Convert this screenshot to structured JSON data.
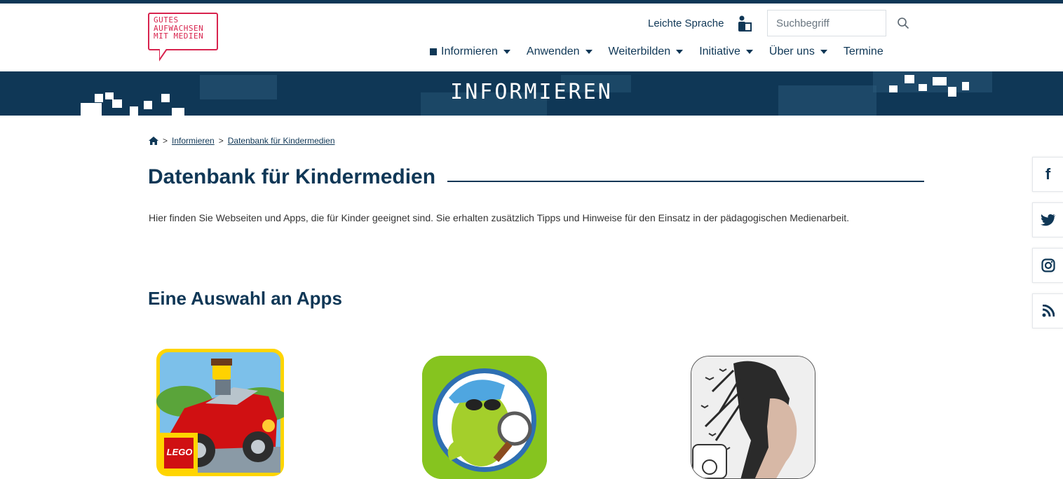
{
  "logo": {
    "line1": "GUTES",
    "line2": "AUFWACHSEN",
    "line3": "MIT MEDIEN"
  },
  "header": {
    "leichte_sprache": "Leichte Sprache",
    "search_placeholder": "Suchbegriff"
  },
  "nav": {
    "items": [
      {
        "label": "Informieren",
        "active": true,
        "dropdown": true
      },
      {
        "label": "Anwenden",
        "dropdown": true
      },
      {
        "label": "Weiterbilden",
        "dropdown": true
      },
      {
        "label": "Initiative",
        "dropdown": true
      },
      {
        "label": "Über uns",
        "dropdown": true
      },
      {
        "label": "Termine",
        "dropdown": false
      }
    ]
  },
  "banner": {
    "title": "INFORMIEREN"
  },
  "breadcrumb": {
    "home_icon": "home-icon",
    "items": [
      "Informieren",
      "Datenbank für Kindermedien"
    ],
    "separator": ">"
  },
  "page": {
    "title": "Datenbank für Kindermedien",
    "intro": "Hier finden Sie Webseiten und Apps, die für Kinder geeignet sind. Sie erhalten zusätzlich Tipps und Hinweise für den Einsatz in der pädagogischen Medienarbeit.",
    "section_title": "Eine Auswahl an Apps"
  },
  "apps": [
    {
      "icon": "lego-car-app-icon",
      "badge": "LEGO"
    },
    {
      "icon": "detective-mascot-app-icon"
    },
    {
      "icon": "portrait-birds-app-icon"
    }
  ],
  "social": [
    "facebook-icon",
    "twitter-icon",
    "instagram-icon",
    "rss-icon"
  ],
  "colors": {
    "primary": "#0f3756",
    "logo": "#d8234e",
    "lego_red": "#d01012",
    "lego_yellow": "#ffd500"
  }
}
